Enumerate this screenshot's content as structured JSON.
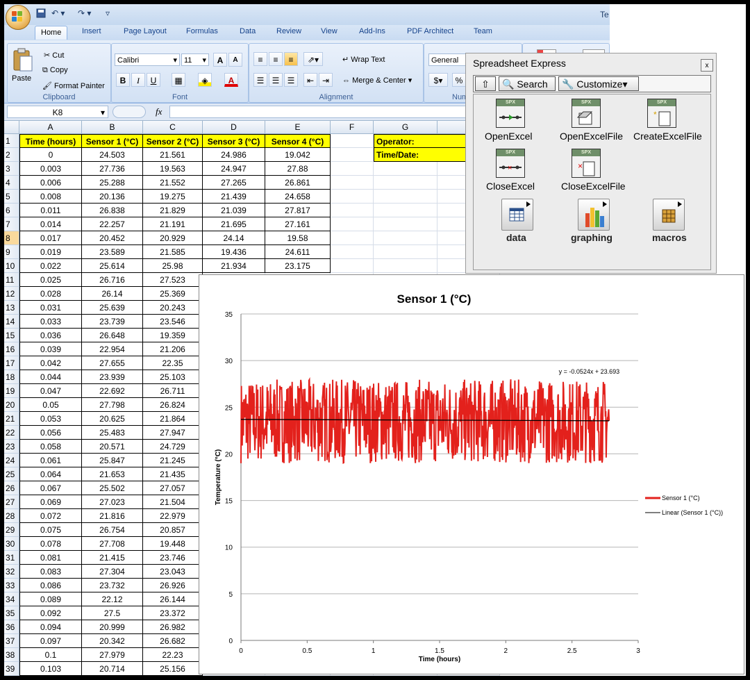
{
  "window": {
    "title_fragment": "Te"
  },
  "ribbon": {
    "tabs": [
      "Home",
      "Insert",
      "Page Layout",
      "Formulas",
      "Data",
      "Review",
      "View",
      "Add-Ins",
      "PDF Architect",
      "Team"
    ],
    "clipboard": {
      "paste": "Paste",
      "cut": "Cut",
      "copy": "Copy",
      "format_painter": "Format Painter",
      "label": "Clipboard"
    },
    "font": {
      "name": "Calibri",
      "size": "11",
      "grow": "A",
      "shrink": "A",
      "bold": "B",
      "italic": "I",
      "underline": "U",
      "label": "Font"
    },
    "alignment": {
      "wrap": "Wrap Text",
      "merge": "Merge & Center",
      "label": "Alignment"
    },
    "number": {
      "format": "General",
      "currency": "$",
      "percent": "%",
      "label": "Num"
    }
  },
  "formula_bar": {
    "name_box": "K8",
    "fx": "fx"
  },
  "sheet": {
    "columns": [
      "A",
      "B",
      "C",
      "D",
      "E",
      "F",
      "G"
    ],
    "headers": [
      "Time (hours)",
      "Sensor 1 (°C)",
      "Sensor 2 (°C)",
      "Sensor 3 (°C)",
      "Sensor 4 (°C)"
    ],
    "labels": [
      "Operator:",
      "Time/Date:"
    ],
    "row_numbers": [
      "1",
      "2",
      "3",
      "4",
      "5",
      "6",
      "7",
      "8",
      "9",
      "10",
      "11",
      "12",
      "13",
      "14",
      "15",
      "16",
      "17",
      "18",
      "19",
      "20",
      "21",
      "22",
      "23",
      "24",
      "25",
      "26",
      "27",
      "28",
      "29",
      "30",
      "31",
      "32",
      "33",
      "34",
      "35",
      "36",
      "37",
      "38",
      "39"
    ],
    "rows": [
      [
        "0",
        "24.503",
        "21.561",
        "24.986",
        "19.042"
      ],
      [
        "0.003",
        "27.736",
        "19.563",
        "24.947",
        "27.88"
      ],
      [
        "0.006",
        "25.288",
        "21.552",
        "27.265",
        "26.861"
      ],
      [
        "0.008",
        "20.136",
        "19.275",
        "21.439",
        "24.658"
      ],
      [
        "0.011",
        "26.838",
        "21.829",
        "21.039",
        "27.817"
      ],
      [
        "0.014",
        "22.257",
        "21.191",
        "21.695",
        "27.161"
      ],
      [
        "0.017",
        "20.452",
        "20.929",
        "24.14",
        "19.58"
      ],
      [
        "0.019",
        "23.589",
        "21.585",
        "19.436",
        "24.611"
      ],
      [
        "0.022",
        "25.614",
        "25.98",
        "21.934",
        "23.175"
      ],
      [
        "0.025",
        "26.716",
        "27.523"
      ],
      [
        "0.028",
        "26.14",
        "25.369"
      ],
      [
        "0.031",
        "25.639",
        "20.243"
      ],
      [
        "0.033",
        "23.739",
        "23.546"
      ],
      [
        "0.036",
        "26.648",
        "19.359"
      ],
      [
        "0.039",
        "22.954",
        "21.206"
      ],
      [
        "0.042",
        "27.655",
        "22.35"
      ],
      [
        "0.044",
        "23.939",
        "25.103"
      ],
      [
        "0.047",
        "22.692",
        "26.711"
      ],
      [
        "0.05",
        "27.798",
        "26.824"
      ],
      [
        "0.053",
        "20.625",
        "21.864"
      ],
      [
        "0.056",
        "25.483",
        "27.947"
      ],
      [
        "0.058",
        "20.571",
        "24.729"
      ],
      [
        "0.061",
        "25.847",
        "21.245"
      ],
      [
        "0.064",
        "21.653",
        "21.435"
      ],
      [
        "0.067",
        "25.502",
        "27.057"
      ],
      [
        "0.069",
        "27.023",
        "21.504"
      ],
      [
        "0.072",
        "21.816",
        "22.979"
      ],
      [
        "0.075",
        "26.754",
        "20.857"
      ],
      [
        "0.078",
        "27.708",
        "19.448"
      ],
      [
        "0.081",
        "21.415",
        "23.746"
      ],
      [
        "0.083",
        "27.304",
        "23.043"
      ],
      [
        "0.086",
        "23.732",
        "26.926"
      ],
      [
        "0.089",
        "22.12",
        "26.144"
      ],
      [
        "0.092",
        "27.5",
        "23.372"
      ],
      [
        "0.094",
        "20.999",
        "26.982"
      ],
      [
        "0.097",
        "20.342",
        "26.682"
      ],
      [
        "0.1",
        "27.979",
        "22.23"
      ],
      [
        "0.103",
        "20.714",
        "25.156"
      ]
    ],
    "selected_row": "8"
  },
  "spreadsheet_express": {
    "title": "Spreadsheet Express",
    "close": "x",
    "toolbar": {
      "up": "⇧",
      "search": "Search",
      "customize": "Customize"
    },
    "band": "SPX",
    "vis": [
      "OpenExcel",
      "OpenExcelFile",
      "CreateExcelFile",
      "CloseExcel",
      "CloseExcelFile"
    ],
    "palettes": [
      "data",
      "graphing",
      "macros"
    ]
  },
  "chart_data": {
    "type": "line",
    "title": "Sensor 1 (°C)",
    "xlabel": "Time (hours)",
    "ylabel": "Temperature (°C)",
    "xlim": [
      0,
      3
    ],
    "ylim": [
      0,
      35
    ],
    "x_ticks": [
      "0",
      "0.5",
      "1",
      "1.5",
      "2",
      "2.5",
      "3"
    ],
    "y_ticks": [
      "0",
      "5",
      "10",
      "15",
      "20",
      "25",
      "30",
      "35"
    ],
    "grid": "horizontal",
    "legend_position": "right",
    "series": [
      {
        "name": "Sensor 1 (°C)",
        "color": "#e3211c",
        "x_range": [
          0,
          2.78
        ],
        "y_range": [
          19,
          28
        ],
        "note_shape": "dense noise"
      },
      {
        "name": "Linear (Sensor 1 (°C))",
        "color": "#000000",
        "slope": -0.0524,
        "intercept": 23.693,
        "x_range": [
          0,
          2.78
        ]
      }
    ],
    "trendline_label": "y = -0.0524x + 23.693"
  }
}
